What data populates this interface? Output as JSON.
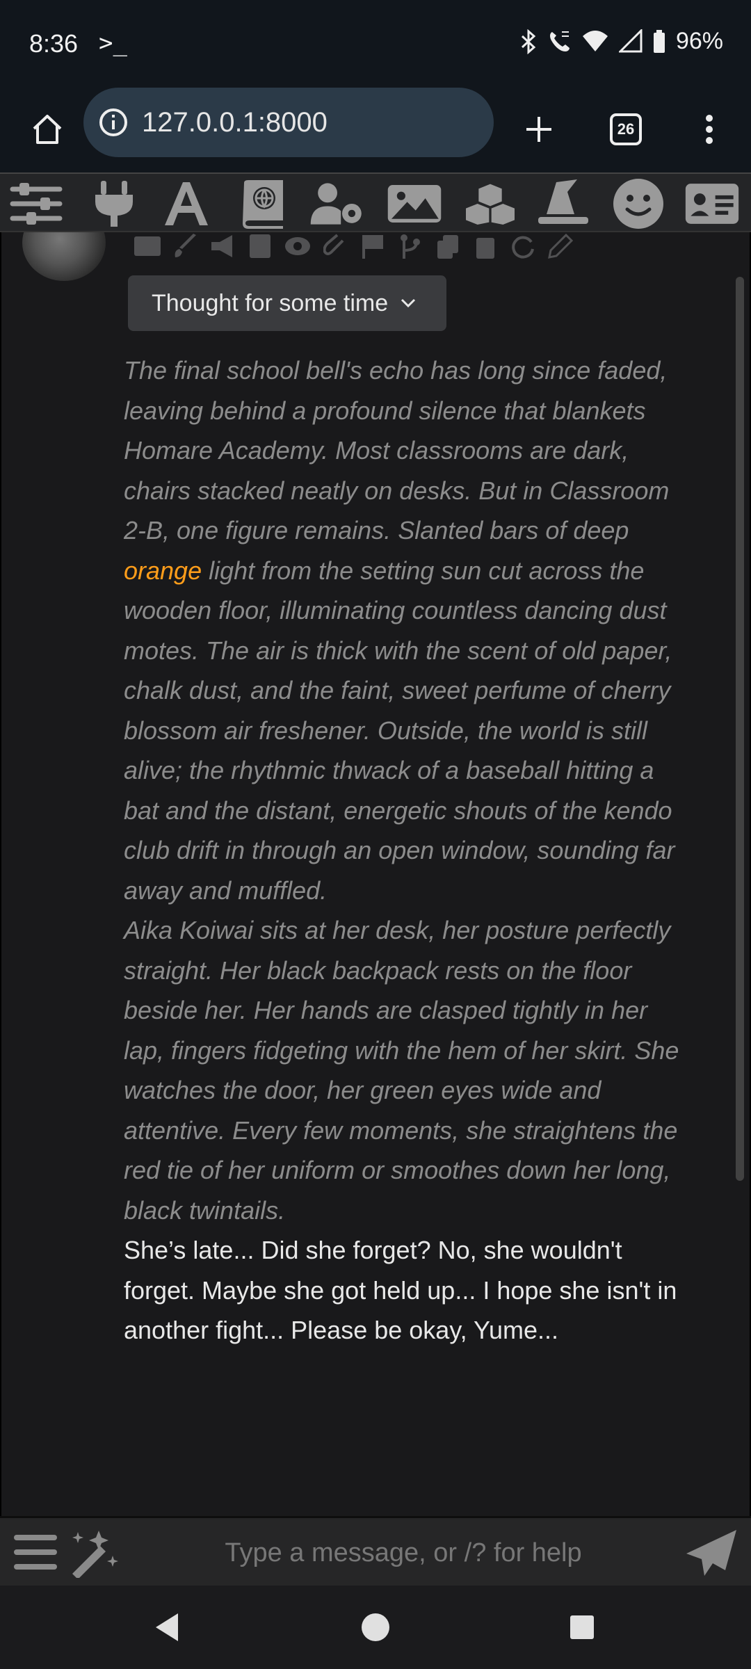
{
  "status_bar": {
    "time": "8:36",
    "terminal_glyph": ">_",
    "battery": "96%"
  },
  "browser": {
    "url": "127.0.0.1:8000",
    "tab_count": "26"
  },
  "toolbar": {
    "tools": [
      "sliders-icon",
      "plug-icon",
      "font-icon",
      "book-globe-icon",
      "user-gear-icon",
      "image-icon",
      "cubes-icon",
      "wizard-hat-icon",
      "smile-icon",
      "id-card-icon"
    ]
  },
  "chat": {
    "reasoning_label": "Thought for some time",
    "message": {
      "para1_before": "The final school bell's echo has long since faded, leaving behind a profound silence that blankets Homare Academy. Most classrooms are dark, chairs stacked neatly on desks. But in Classroom 2-B, one figure remains. Slanted bars of deep ",
      "para1_highlight": "orange",
      "para1_after": " light from the setting sun cut across the wooden floor, illuminating countless dancing dust motes. The air is thick with the scent of old paper, chalk dust, and the faint, sweet perfume of cherry blossom air freshener. Outside, the world is still alive; the rhythmic thwack of a baseball hitting a bat and the distant, energetic shouts of the kendo club drift in through an open window, sounding far away and muffled.",
      "para2": "Aika Koiwai sits at her desk, her posture perfectly straight. Her black backpack rests on the floor beside her. Her hands are clasped tightly in her lap, fingers fidgeting with the hem of her skirt. She watches the door, her green eyes wide and attentive. Every few moments, she straightens the red tie of her uniform or smoothes down her long, black twintails.",
      "para3": "She’s late... Did she forget? No, she wouldn't forget. Maybe she got held up... I hope she isn't in another fight... Please be okay, Yume..."
    },
    "highlight_color": "#ff9d1a"
  },
  "input": {
    "placeholder": "Type a message, or /? for help"
  }
}
